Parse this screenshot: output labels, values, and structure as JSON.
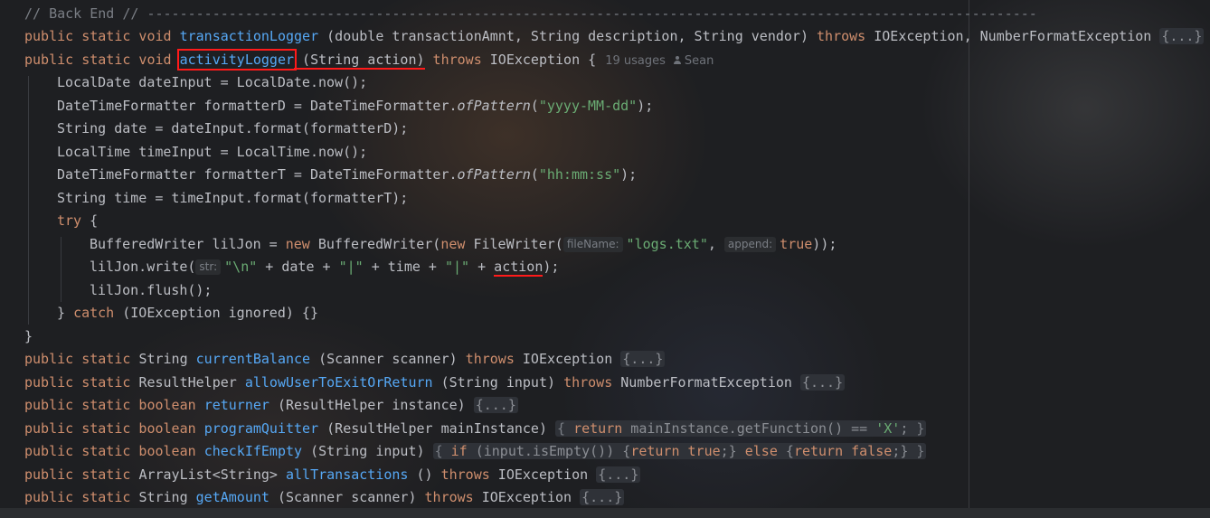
{
  "editor": {
    "lines": {
      "comment": "// Back End // -------------------------------------------------------------------------------------------------------------",
      "l1": {
        "pre": "public static void ",
        "name": "transactionLogger",
        "params": " (double transactionAmnt, String description, String vendor) ",
        "throws": "throws",
        "exc": " IOException, NumberFormatException ",
        "fold": "{...}"
      },
      "l2": {
        "pre": "public static void ",
        "name": "activityLogger",
        "params": " (String action)",
        "throws": " throws",
        "exc": " IOException {",
        "usages": "19 usages",
        "author": "Sean"
      },
      "l3": "LocalDate dateInput = LocalDate.now();",
      "l4": {
        "a": "DateTimeFormatter formatterD = DateTimeFormatter.",
        "m": "ofPattern",
        "b": "(",
        "s": "\"yyyy-MM-dd\"",
        "c": ");"
      },
      "l5": "String date = dateInput.format(formatterD);",
      "l6": "LocalTime timeInput = LocalTime.now();",
      "l7": {
        "a": "DateTimeFormatter formatterT = DateTimeFormatter.",
        "m": "ofPattern",
        "b": "(",
        "s": "\"hh:mm:ss\"",
        "c": ");"
      },
      "l8": "String time = timeInput.format(formatterT);",
      "l9": {
        "kw": "try",
        "rest": " {"
      },
      "l10": {
        "a": "BufferedWriter lilJon = ",
        "new1": "new",
        "b": " BufferedWriter(",
        "new2": "new",
        "c": " FileWriter(",
        "hint1": "fileName:",
        "s": "\"logs.txt\"",
        "d": ", ",
        "hint2": "append:",
        "t": "true",
        "e": "));"
      },
      "l11": {
        "a": "lilJon.write(",
        "hint": "str:",
        "s1": "\"\\n\"",
        "b": " + date + ",
        "s2": "\"|\"",
        "c": " + time + ",
        "s3": "\"|\"",
        "d": " + ",
        "act": "action",
        "e": ");"
      },
      "l12": "lilJon.flush();",
      "l13": {
        "a": "} ",
        "kw": "catch",
        "b": " (IOException ignored) {}"
      },
      "l14": "}",
      "l15": {
        "pre": "public static String ",
        "name": "currentBalance",
        "params": " (Scanner scanner) ",
        "throws": "throws",
        "exc": " IOException ",
        "fold": "{...}"
      },
      "l16": {
        "pre": "public static ResultHelper ",
        "name": "allowUserToExitOrReturn",
        "params": " (String input) ",
        "throws": "throws",
        "exc": " NumberFormatException ",
        "fold": "{...}"
      },
      "l17": {
        "pre": "public static boolean ",
        "name": "returner",
        "params": " (ResultHelper instance) ",
        "fold": "{...}"
      },
      "l18": {
        "pre": "public static boolean ",
        "name": "programQuitter",
        "params": " (ResultHelper mainInstance) ",
        "body": "{ return mainInstance.getFunction() == 'X'; }"
      },
      "l19": {
        "pre": "public static boolean ",
        "name": "checkIfEmpty",
        "params": " (String input) ",
        "body": "{ if (input.isEmpty()) {return true;} else {return false;} }"
      },
      "l20": {
        "pre": "public static ArrayList<String> ",
        "name": "allTransactions",
        "params": " () ",
        "throws": "throws",
        "exc": " IOException ",
        "fold": "{...}"
      },
      "l21": {
        "pre": "public static String ",
        "name": "getAmount",
        "params": " (Scanner scanner) ",
        "throws": "throws",
        "exc": " IOException ",
        "fold": "{...}"
      }
    }
  }
}
